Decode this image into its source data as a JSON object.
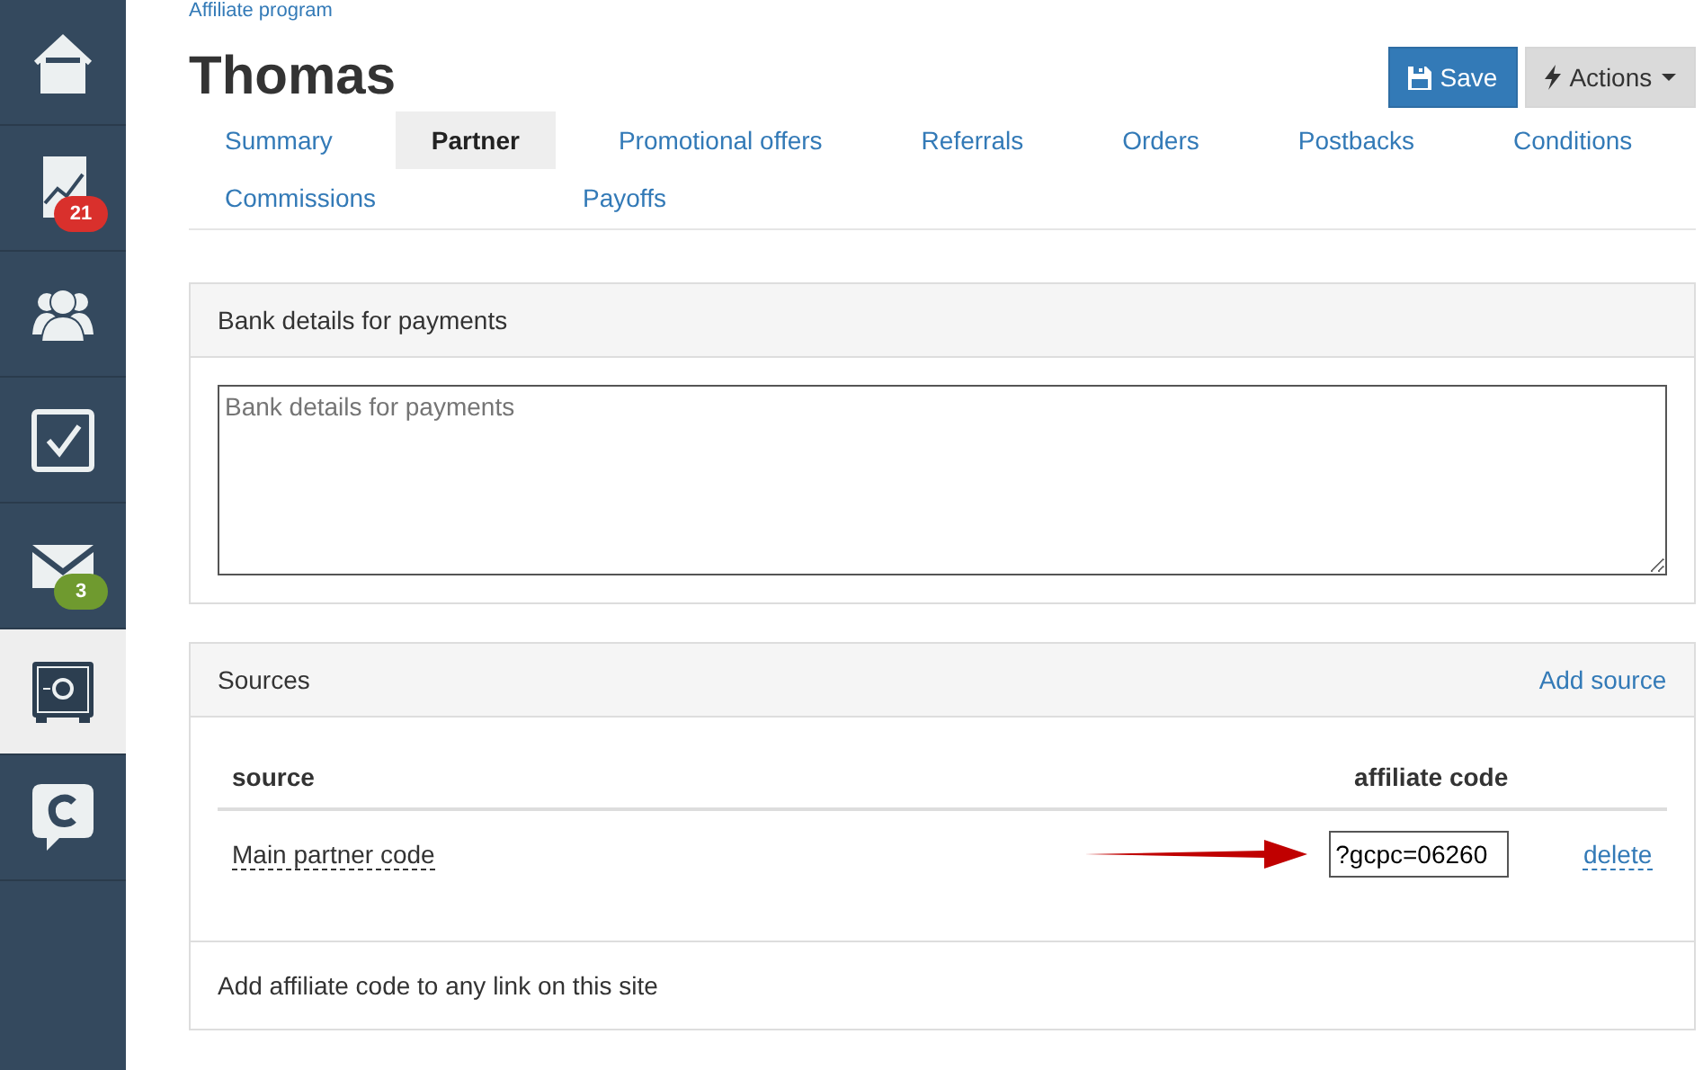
{
  "sidebar": {
    "items": [
      {
        "kind": "home",
        "selected": false
      },
      {
        "kind": "chart",
        "selected": false,
        "badge": "21",
        "color": "#d9302c"
      },
      {
        "kind": "users",
        "selected": false
      },
      {
        "kind": "tasks",
        "selected": false
      },
      {
        "kind": "mail",
        "selected": false,
        "badge": "3",
        "color": "#6f9a2f"
      },
      {
        "kind": "safe",
        "selected": true
      },
      {
        "kind": "chat",
        "selected": false
      }
    ]
  },
  "breadcrumb": "Affiliate program",
  "title": "Thomas",
  "buttons": {
    "save": "Save",
    "actions": "Actions"
  },
  "tab_rows": [
    [
      {
        "label": "Summary",
        "selected": false
      },
      {
        "label": "Partner",
        "selected": true
      },
      {
        "label": "Promotional offers",
        "selected": false
      },
      {
        "label": "Referrals",
        "selected": false
      },
      {
        "label": "Orders",
        "selected": false
      },
      {
        "label": "Postbacks",
        "selected": false
      },
      {
        "label": "Conditions",
        "selected": false
      }
    ],
    [
      {
        "label": "Commissions",
        "selected": false
      },
      {
        "label": "Payoffs",
        "selected": false
      }
    ]
  ],
  "bank_panel": {
    "title": "Bank details for payments",
    "placeholder": "Bank details for payments"
  },
  "sources_panel": {
    "title": "Sources",
    "add_link": "Add source",
    "columns": [
      "source",
      "affiliate code"
    ],
    "rows": [
      {
        "source": "Main partner code",
        "code": "?gcpc=06260",
        "action": "delete"
      }
    ],
    "footer": "Add affiliate code to any link on this site"
  }
}
